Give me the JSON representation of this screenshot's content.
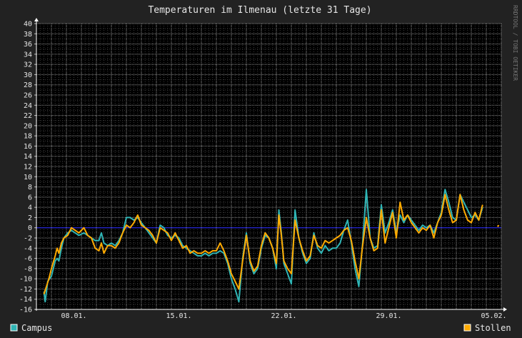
{
  "chart_data": {
    "type": "line",
    "title": "Temperaturen im Ilmenau (letzte 31 Tage)",
    "watermark": "RRDTOOL / TOBI OETIKER",
    "xlabel": "",
    "ylabel": "",
    "ylim": [
      -16,
      40
    ],
    "y_ticks": [
      -16,
      -14,
      -12,
      -10,
      -8,
      -6,
      -4,
      -2,
      0,
      2,
      4,
      6,
      8,
      10,
      12,
      14,
      16,
      18,
      20,
      22,
      24,
      26,
      28,
      30,
      32,
      34,
      36,
      38,
      40
    ],
    "x_range": [
      "2014-01-06",
      "2014-02-06"
    ],
    "x_ticks": [
      {
        "date": "2014-01-08",
        "label": "08.01."
      },
      {
        "date": "2014-01-15",
        "label": "15.01."
      },
      {
        "date": "2014-01-22",
        "label": "22.01."
      },
      {
        "date": "2014-01-29",
        "label": "29.01."
      },
      {
        "date": "2014-02-05",
        "label": "05.02."
      }
    ],
    "grid": true,
    "background": "#000000",
    "zero_line_color": "#2222ff",
    "legend_placement": "bottom",
    "series": [
      {
        "name": "Campus",
        "color": "#2fb5b5",
        "points": [
          [
            "2014-01-06 12:00",
            -12.5
          ],
          [
            "2014-01-06 14:00",
            -14.5
          ],
          [
            "2014-01-06 18:00",
            -10.5
          ],
          [
            "2014-01-07 00:00",
            -9.5
          ],
          [
            "2014-01-07 06:00",
            -6.5
          ],
          [
            "2014-01-07 09:00",
            -6.0
          ],
          [
            "2014-01-07 12:00",
            -6.5
          ],
          [
            "2014-01-07 16:00",
            -4.0
          ],
          [
            "2014-01-07 20:00",
            -2.0
          ],
          [
            "2014-01-08 02:00",
            -1.0
          ],
          [
            "2014-01-08 08:00",
            -0.5
          ],
          [
            "2014-01-08 14:00",
            -1.0
          ],
          [
            "2014-01-08 20:00",
            -1.5
          ],
          [
            "2014-01-09 04:00",
            -1.0
          ],
          [
            "2014-01-09 10:00",
            -1.5
          ],
          [
            "2014-01-09 16:00",
            -2.0
          ],
          [
            "2014-01-09 22:00",
            -2.5
          ],
          [
            "2014-01-10 04:00",
            -2.5
          ],
          [
            "2014-01-10 08:00",
            -1.0
          ],
          [
            "2014-01-10 12:00",
            -3.0
          ],
          [
            "2014-01-10 18:00",
            -3.5
          ],
          [
            "2014-01-11 00:00",
            -3.0
          ],
          [
            "2014-01-11 06:00",
            -3.5
          ],
          [
            "2014-01-11 12:00",
            -2.5
          ],
          [
            "2014-01-11 18:00",
            -1.0
          ],
          [
            "2014-01-12 00:00",
            2.0
          ],
          [
            "2014-01-12 06:00",
            2.0
          ],
          [
            "2014-01-12 12:00",
            1.5
          ],
          [
            "2014-01-12 18:00",
            2.0
          ],
          [
            "2014-01-13 00:00",
            1.0
          ],
          [
            "2014-01-13 06:00",
            0.0
          ],
          [
            "2014-01-13 12:00",
            -1.0
          ],
          [
            "2014-01-13 18:00",
            -2.0
          ],
          [
            "2014-01-14 00:00",
            -3.0
          ],
          [
            "2014-01-14 06:00",
            0.5
          ],
          [
            "2014-01-14 12:00",
            0.0
          ],
          [
            "2014-01-14 18:00",
            -1.5
          ],
          [
            "2014-01-15 00:00",
            -2.0
          ],
          [
            "2014-01-15 06:00",
            -1.5
          ],
          [
            "2014-01-15 12:00",
            -2.0
          ],
          [
            "2014-01-15 18:00",
            -3.5
          ],
          [
            "2014-01-16 00:00",
            -4.0
          ],
          [
            "2014-01-16 06:00",
            -4.5
          ],
          [
            "2014-01-16 12:00",
            -5.0
          ],
          [
            "2014-01-16 18:00",
            -5.5
          ],
          [
            "2014-01-17 00:00",
            -5.5
          ],
          [
            "2014-01-17 06:00",
            -5.0
          ],
          [
            "2014-01-17 12:00",
            -5.5
          ],
          [
            "2014-01-17 18:00",
            -5.0
          ],
          [
            "2014-01-18 00:00",
            -5.0
          ],
          [
            "2014-01-18 06:00",
            -4.5
          ],
          [
            "2014-01-18 12:00",
            -5.0
          ],
          [
            "2014-01-18 18:00",
            -7.0
          ],
          [
            "2014-01-19 00:00",
            -10.0
          ],
          [
            "2014-01-19 06:00",
            -12.0
          ],
          [
            "2014-01-19 12:00",
            -14.5
          ],
          [
            "2014-01-19 18:00",
            -6.0
          ],
          [
            "2014-01-20 00:00",
            -1.0
          ],
          [
            "2014-01-20 06:00",
            -7.0
          ],
          [
            "2014-01-20 12:00",
            -9.0
          ],
          [
            "2014-01-20 18:00",
            -8.0
          ],
          [
            "2014-01-21 00:00",
            -4.0
          ],
          [
            "2014-01-21 06:00",
            -1.5
          ],
          [
            "2014-01-21 12:00",
            -2.0
          ],
          [
            "2014-01-21 18:00",
            -4.0
          ],
          [
            "2014-01-22 00:00",
            -8.0
          ],
          [
            "2014-01-22 04:00",
            3.5
          ],
          [
            "2014-01-22 08:00",
            -1.0
          ],
          [
            "2014-01-22 12:00",
            -7.0
          ],
          [
            "2014-01-22 18:00",
            -9.0
          ],
          [
            "2014-01-23 00:00",
            -11.0
          ],
          [
            "2014-01-23 06:00",
            3.5
          ],
          [
            "2014-01-23 12:00",
            -2.0
          ],
          [
            "2014-01-23 18:00",
            -5.0
          ],
          [
            "2014-01-24 00:00",
            -7.0
          ],
          [
            "2014-01-24 06:00",
            -6.0
          ],
          [
            "2014-01-24 12:00",
            -1.0
          ],
          [
            "2014-01-24 18:00",
            -4.0
          ],
          [
            "2014-01-25 00:00",
            -5.0
          ],
          [
            "2014-01-25 06:00",
            -3.5
          ],
          [
            "2014-01-25 12:00",
            -4.5
          ],
          [
            "2014-01-25 18:00",
            -4.0
          ],
          [
            "2014-01-26 00:00",
            -4.0
          ],
          [
            "2014-01-26 06:00",
            -3.0
          ],
          [
            "2014-01-26 12:00",
            -0.5
          ],
          [
            "2014-01-26 18:00",
            1.5
          ],
          [
            "2014-01-27 00:00",
            -3.0
          ],
          [
            "2014-01-27 06:00",
            -8.0
          ],
          [
            "2014-01-27 12:00",
            -11.5
          ],
          [
            "2014-01-27 18:00",
            -3.0
          ],
          [
            "2014-01-28 00:00",
            7.5
          ],
          [
            "2014-01-28 06:00",
            -2.0
          ],
          [
            "2014-01-28 12:00",
            -4.0
          ],
          [
            "2014-01-28 18:00",
            -3.5
          ],
          [
            "2014-01-29 00:00",
            4.5
          ],
          [
            "2014-01-29 06:00",
            -1.0
          ],
          [
            "2014-01-29 12:00",
            1.0
          ],
          [
            "2014-01-29 18:00",
            3.5
          ],
          [
            "2014-01-30 00:00",
            -1.0
          ],
          [
            "2014-01-30 06:00",
            2.5
          ],
          [
            "2014-01-30 12:00",
            1.0
          ],
          [
            "2014-01-30 18:00",
            2.5
          ],
          [
            "2014-01-31 00:00",
            1.5
          ],
          [
            "2014-01-31 06:00",
            0.5
          ],
          [
            "2014-01-31 12:00",
            -0.5
          ],
          [
            "2014-01-31 18:00",
            0.5
          ],
          [
            "2014-02-01 00:00",
            0.0
          ],
          [
            "2014-02-01 06:00",
            0.5
          ],
          [
            "2014-02-01 12:00",
            -1.0
          ],
          [
            "2014-02-01 18:00",
            1.0
          ],
          [
            "2014-02-02 00:00",
            3.0
          ],
          [
            "2014-02-02 06:00",
            7.5
          ],
          [
            "2014-02-02 12:00",
            5.0
          ],
          [
            "2014-02-02 18:00",
            2.0
          ],
          [
            "2014-02-03 00:00",
            1.5
          ],
          [
            "2014-02-03 06:00",
            6.5
          ],
          [
            "2014-02-03 12:00",
            5.0
          ],
          [
            "2014-02-03 18:00",
            3.5
          ],
          [
            "2014-02-04 00:00",
            2.0
          ],
          [
            "2014-02-04 06:00",
            2.5
          ],
          [
            "2014-02-04 12:00",
            1.5
          ],
          [
            "2014-02-04 18:00",
            4.0
          ]
        ]
      },
      {
        "name": "Stollen",
        "color": "#ffaa00",
        "points": [
          [
            "2014-01-06 12:00",
            -13.0
          ],
          [
            "2014-01-06 16:00",
            -11.5
          ],
          [
            "2014-01-06 20:00",
            -10.0
          ],
          [
            "2014-01-07 00:00",
            -8.0
          ],
          [
            "2014-01-07 06:00",
            -5.5
          ],
          [
            "2014-01-07 09:00",
            -4.0
          ],
          [
            "2014-01-07 12:00",
            -5.0
          ],
          [
            "2014-01-07 16:00",
            -3.0
          ],
          [
            "2014-01-07 20:00",
            -2.0
          ],
          [
            "2014-01-08 02:00",
            -1.5
          ],
          [
            "2014-01-08 08:00",
            0.0
          ],
          [
            "2014-01-08 14:00",
            -0.5
          ],
          [
            "2014-01-08 20:00",
            -1.0
          ],
          [
            "2014-01-09 04:00",
            0.0
          ],
          [
            "2014-01-09 10:00",
            -1.5
          ],
          [
            "2014-01-09 16:00",
            -2.0
          ],
          [
            "2014-01-09 22:00",
            -4.0
          ],
          [
            "2014-01-10 04:00",
            -4.5
          ],
          [
            "2014-01-10 08:00",
            -3.0
          ],
          [
            "2014-01-10 12:00",
            -5.0
          ],
          [
            "2014-01-10 18:00",
            -3.5
          ],
          [
            "2014-01-11 00:00",
            -3.5
          ],
          [
            "2014-01-11 06:00",
            -4.0
          ],
          [
            "2014-01-11 12:00",
            -3.0
          ],
          [
            "2014-01-11 18:00",
            -1.0
          ],
          [
            "2014-01-12 00:00",
            0.5
          ],
          [
            "2014-01-12 06:00",
            0.0
          ],
          [
            "2014-01-12 12:00",
            1.0
          ],
          [
            "2014-01-12 18:00",
            2.5
          ],
          [
            "2014-01-13 00:00",
            0.5
          ],
          [
            "2014-01-13 06:00",
            0.0
          ],
          [
            "2014-01-13 12:00",
            -0.5
          ],
          [
            "2014-01-13 18:00",
            -1.5
          ],
          [
            "2014-01-14 00:00",
            -3.0
          ],
          [
            "2014-01-14 06:00",
            0.0
          ],
          [
            "2014-01-14 12:00",
            -0.5
          ],
          [
            "2014-01-14 18:00",
            -1.0
          ],
          [
            "2014-01-15 00:00",
            -2.5
          ],
          [
            "2014-01-15 06:00",
            -1.0
          ],
          [
            "2014-01-15 12:00",
            -2.5
          ],
          [
            "2014-01-15 18:00",
            -4.0
          ],
          [
            "2014-01-16 00:00",
            -3.5
          ],
          [
            "2014-01-16 06:00",
            -5.0
          ],
          [
            "2014-01-16 12:00",
            -4.5
          ],
          [
            "2014-01-16 18:00",
            -5.0
          ],
          [
            "2014-01-17 00:00",
            -5.0
          ],
          [
            "2014-01-17 06:00",
            -4.5
          ],
          [
            "2014-01-17 12:00",
            -5.0
          ],
          [
            "2014-01-17 18:00",
            -4.5
          ],
          [
            "2014-01-18 00:00",
            -4.5
          ],
          [
            "2014-01-18 06:00",
            -3.0
          ],
          [
            "2014-01-18 12:00",
            -4.5
          ],
          [
            "2014-01-18 18:00",
            -6.5
          ],
          [
            "2014-01-19 00:00",
            -9.0
          ],
          [
            "2014-01-19 06:00",
            -10.5
          ],
          [
            "2014-01-19 12:00",
            -12.0
          ],
          [
            "2014-01-19 18:00",
            -6.5
          ],
          [
            "2014-01-20 00:00",
            -1.5
          ],
          [
            "2014-01-20 06:00",
            -6.5
          ],
          [
            "2014-01-20 12:00",
            -8.5
          ],
          [
            "2014-01-20 18:00",
            -7.5
          ],
          [
            "2014-01-21 00:00",
            -3.5
          ],
          [
            "2014-01-21 06:00",
            -1.0
          ],
          [
            "2014-01-21 12:00",
            -2.0
          ],
          [
            "2014-01-21 18:00",
            -4.0
          ],
          [
            "2014-01-22 00:00",
            -7.0
          ],
          [
            "2014-01-22 04:00",
            2.5
          ],
          [
            "2014-01-22 08:00",
            -1.5
          ],
          [
            "2014-01-22 12:00",
            -6.5
          ],
          [
            "2014-01-22 18:00",
            -8.0
          ],
          [
            "2014-01-23 00:00",
            -9.0
          ],
          [
            "2014-01-23 06:00",
            1.5
          ],
          [
            "2014-01-23 12:00",
            -2.0
          ],
          [
            "2014-01-23 18:00",
            -4.5
          ],
          [
            "2014-01-24 00:00",
            -6.5
          ],
          [
            "2014-01-24 06:00",
            -5.5
          ],
          [
            "2014-01-24 12:00",
            -1.5
          ],
          [
            "2014-01-24 18:00",
            -3.5
          ],
          [
            "2014-01-25 00:00",
            -4.0
          ],
          [
            "2014-01-25 06:00",
            -2.5
          ],
          [
            "2014-01-25 12:00",
            -3.0
          ],
          [
            "2014-01-25 18:00",
            -2.5
          ],
          [
            "2014-01-26 00:00",
            -2.0
          ],
          [
            "2014-01-26 06:00",
            -1.5
          ],
          [
            "2014-01-26 12:00",
            -0.5
          ],
          [
            "2014-01-26 18:00",
            0.0
          ],
          [
            "2014-01-27 00:00",
            -2.5
          ],
          [
            "2014-01-27 06:00",
            -6.5
          ],
          [
            "2014-01-27 12:00",
            -10.0
          ],
          [
            "2014-01-27 18:00",
            -3.5
          ],
          [
            "2014-01-28 00:00",
            2.0
          ],
          [
            "2014-01-28 06:00",
            -2.0
          ],
          [
            "2014-01-28 12:00",
            -4.5
          ],
          [
            "2014-01-28 18:00",
            -4.0
          ],
          [
            "2014-01-29 00:00",
            3.5
          ],
          [
            "2014-01-29 06:00",
            -3.0
          ],
          [
            "2014-01-29 12:00",
            0.0
          ],
          [
            "2014-01-29 18:00",
            3.0
          ],
          [
            "2014-01-30 00:00",
            -2.0
          ],
          [
            "2014-01-30 06:00",
            5.0
          ],
          [
            "2014-01-30 12:00",
            1.5
          ],
          [
            "2014-01-30 18:00",
            2.5
          ],
          [
            "2014-01-31 00:00",
            1.0
          ],
          [
            "2014-01-31 06:00",
            0.0
          ],
          [
            "2014-01-31 12:00",
            -1.0
          ],
          [
            "2014-01-31 18:00",
            0.0
          ],
          [
            "2014-02-01 00:00",
            -0.5
          ],
          [
            "2014-02-01 06:00",
            0.5
          ],
          [
            "2014-02-01 12:00",
            -2.0
          ],
          [
            "2014-02-01 18:00",
            1.0
          ],
          [
            "2014-02-02 00:00",
            2.5
          ],
          [
            "2014-02-02 06:00",
            6.5
          ],
          [
            "2014-02-02 12:00",
            3.5
          ],
          [
            "2014-02-02 18:00",
            1.0
          ],
          [
            "2014-02-03 00:00",
            1.5
          ],
          [
            "2014-02-03 06:00",
            6.5
          ],
          [
            "2014-02-03 12:00",
            3.5
          ],
          [
            "2014-02-03 18:00",
            1.5
          ],
          [
            "2014-02-04 00:00",
            1.0
          ],
          [
            "2014-02-04 06:00",
            3.0
          ],
          [
            "2014-02-04 12:00",
            1.5
          ],
          [
            "2014-02-04 18:00",
            4.5
          ],
          [
            "2014-02-05 18:00",
            0.2
          ],
          [
            "2014-02-05 20:00",
            0.5
          ]
        ]
      }
    ]
  }
}
